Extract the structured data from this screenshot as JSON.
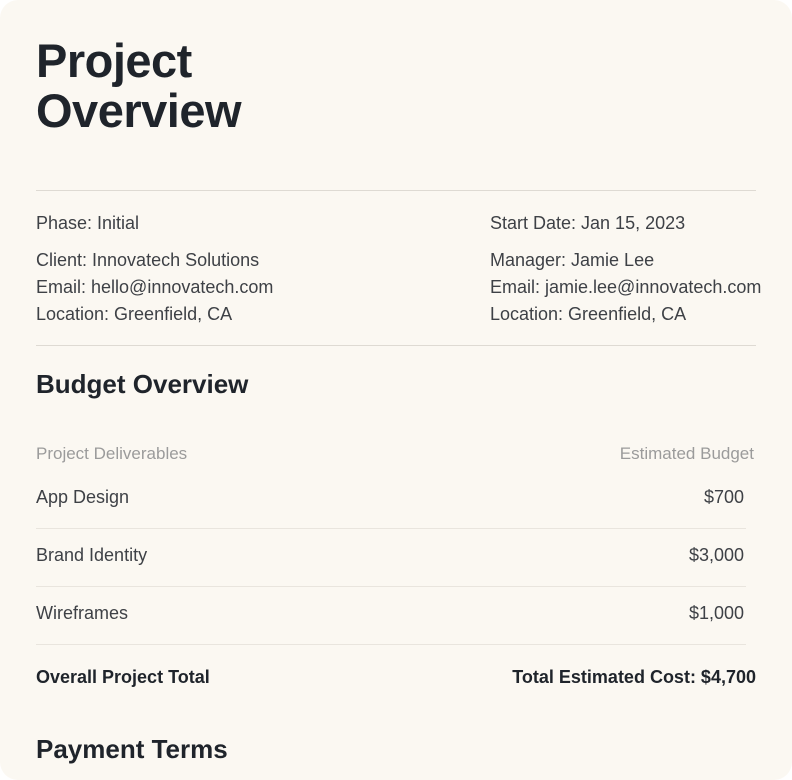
{
  "header": {
    "title_line1": "Project",
    "title_line2": "Overview"
  },
  "project": {
    "phase": "Phase: Initial",
    "start_date": "Start Date: Jan 15, 2023"
  },
  "client": {
    "name": "Client: Innovatech Solutions",
    "email": "Email: hello@innovatech.com",
    "location": "Location: Greenfield, CA"
  },
  "manager": {
    "name": "Manager: Jamie Lee",
    "email": "Email: jamie.lee@innovatech.com",
    "location": "Location: Greenfield, CA"
  },
  "budget": {
    "title": "Budget Overview",
    "columns": [
      "Project Deliverables",
      "Estimated Budget"
    ],
    "rows": [
      {
        "item": "App Design",
        "amount": "$700"
      },
      {
        "item": "Brand Identity",
        "amount": "$3,000"
      },
      {
        "item": "Wireframes",
        "amount": "$1,000"
      }
    ],
    "total_label": "Overall Project Total",
    "total_value": "Total Estimated Cost: $4,700"
  },
  "payment": {
    "title": "Payment Terms"
  }
}
